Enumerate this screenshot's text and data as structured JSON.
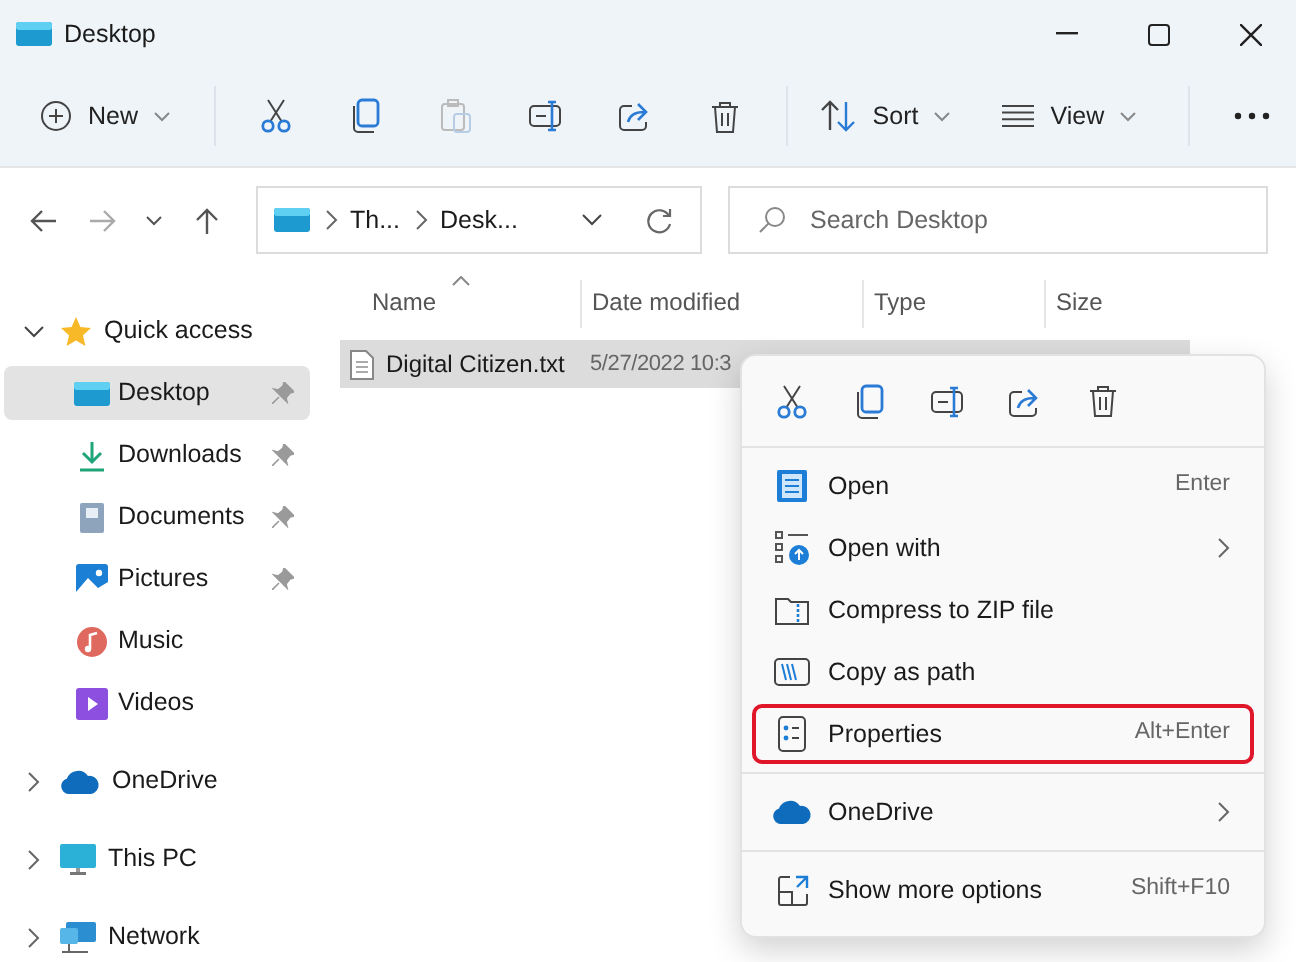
{
  "window": {
    "title": "Desktop"
  },
  "toolbar": [
    {
      "kind": "new",
      "label": "New",
      "disabled": false
    },
    {
      "kind": "cut",
      "disabled": false
    },
    {
      "kind": "copy",
      "disabled": false
    },
    {
      "kind": "paste",
      "disabled": true
    },
    {
      "kind": "rename",
      "disabled": false
    },
    {
      "kind": "share",
      "disabled": false
    },
    {
      "kind": "delete",
      "disabled": false
    },
    {
      "kind": "sort",
      "label": "Sort",
      "disabled": false
    },
    {
      "kind": "view",
      "label": "View",
      "disabled": false
    },
    {
      "kind": "more",
      "disabled": false
    }
  ],
  "address": {
    "segments": [
      "Th...",
      "Desk..."
    ]
  },
  "search": {
    "placeholder": "Search Desktop"
  },
  "sidebar": [
    {
      "kind": "star",
      "label": "Quick access",
      "expanded": true,
      "selected": false,
      "children": [
        {
          "kind": "desktop",
          "label": "Desktop",
          "pinned": true,
          "selected": true
        },
        {
          "kind": "downloads",
          "label": "Downloads",
          "pinned": true,
          "selected": false
        },
        {
          "kind": "documents",
          "label": "Documents",
          "pinned": true,
          "selected": false
        },
        {
          "kind": "pictures",
          "label": "Pictures",
          "pinned": true,
          "selected": false
        },
        {
          "kind": "music",
          "label": "Music",
          "pinned": false,
          "selected": false
        },
        {
          "kind": "videos",
          "label": "Videos",
          "pinned": false,
          "selected": false
        }
      ]
    },
    {
      "kind": "cloud",
      "label": "OneDrive",
      "expanded": false,
      "selected": false
    },
    {
      "kind": "pc",
      "label": "This PC",
      "expanded": false,
      "selected": false
    },
    {
      "kind": "network",
      "label": "Network",
      "expanded": false,
      "selected": false
    }
  ],
  "columns": [
    {
      "label": "Name",
      "sorted": true
    },
    {
      "label": "Date modified",
      "sorted": false
    },
    {
      "label": "Type",
      "sorted": false
    },
    {
      "label": "Size",
      "sorted": false
    }
  ],
  "files": [
    {
      "name": "Digital Citizen.txt",
      "date": "5/27/2022 10:3",
      "selected": true
    }
  ],
  "context_menu": {
    "quick_actions": [
      {
        "kind": "cut"
      },
      {
        "kind": "copy"
      },
      {
        "kind": "rename"
      },
      {
        "kind": "share"
      },
      {
        "kind": "delete"
      }
    ],
    "groups": [
      [
        {
          "kind": "open",
          "label": "Open",
          "shortcut": "Enter",
          "submenu": false,
          "highlighted": false
        },
        {
          "kind": "openwith",
          "label": "Open with",
          "submenu": true,
          "highlighted": false
        },
        {
          "kind": "zip",
          "label": "Compress to ZIP file",
          "submenu": false,
          "highlighted": false
        },
        {
          "kind": "path",
          "label": "Copy as path",
          "submenu": false,
          "highlighted": false
        },
        {
          "kind": "properties",
          "label": "Properties",
          "shortcut": "Alt+Enter",
          "submenu": false,
          "highlighted": true
        }
      ],
      [
        {
          "kind": "cloud",
          "label": "OneDrive",
          "submenu": true,
          "highlighted": false
        }
      ],
      [
        {
          "kind": "more",
          "label": "Show more options",
          "shortcut": "Shift+F10",
          "submenu": false,
          "highlighted": false
        }
      ]
    ]
  }
}
